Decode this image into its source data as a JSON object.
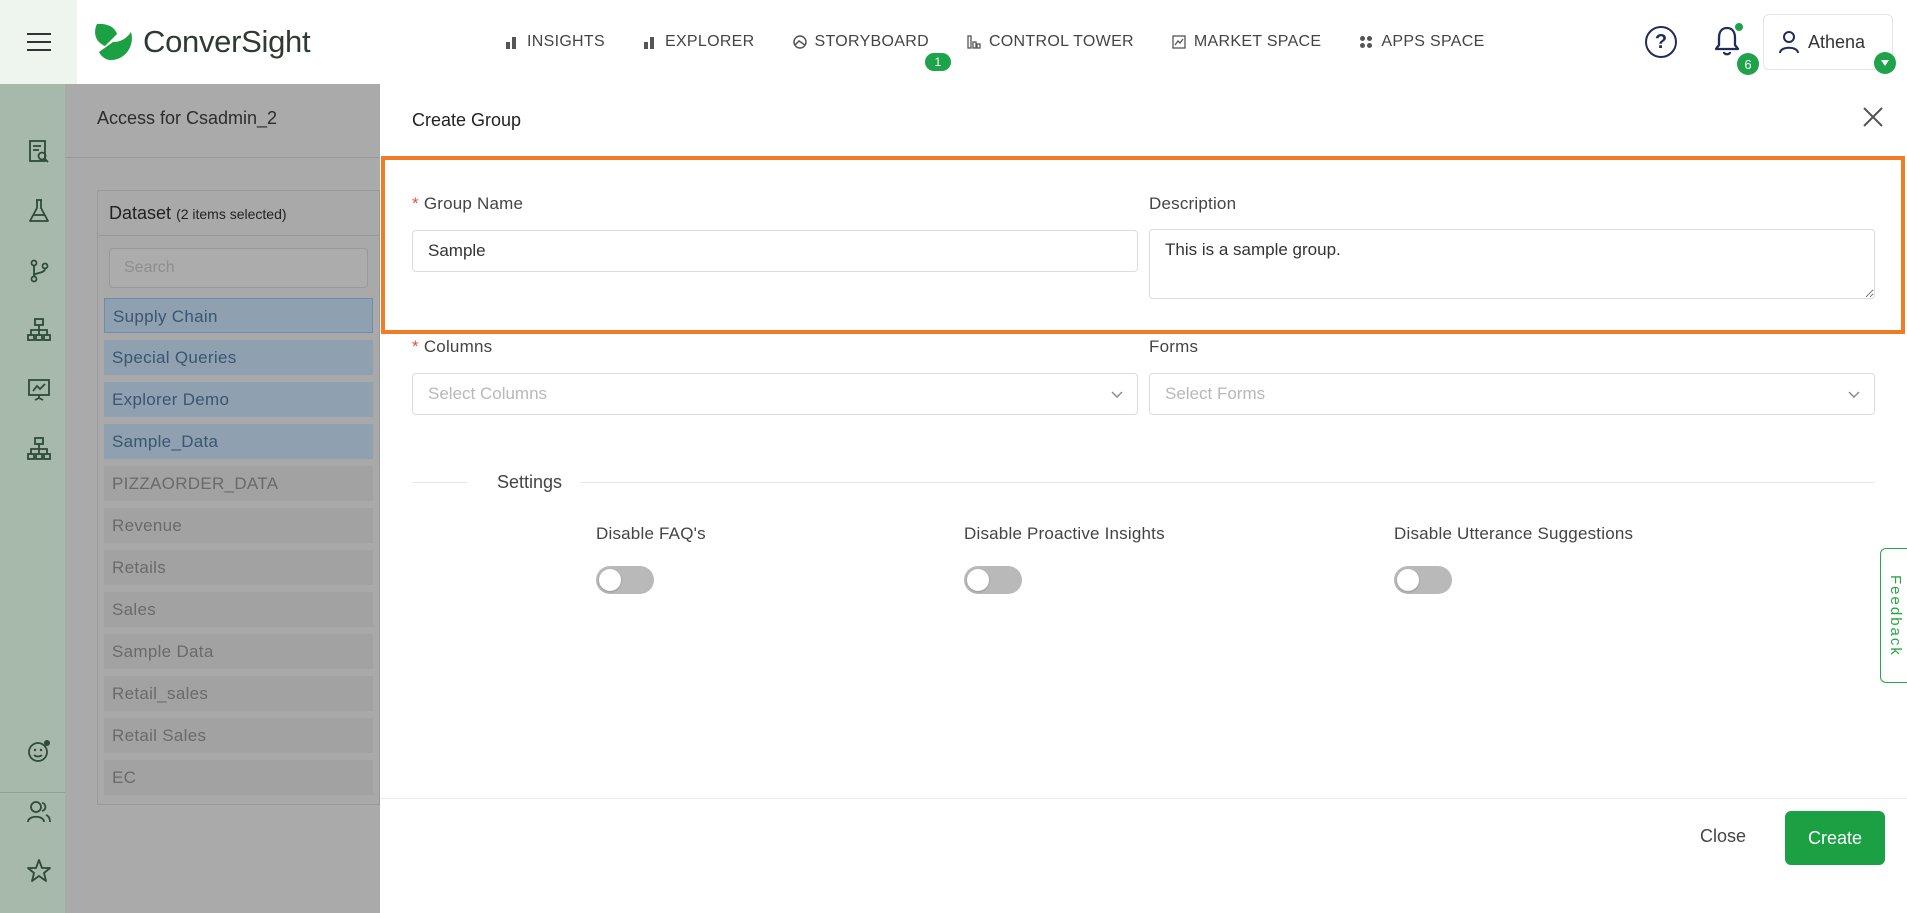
{
  "app": {
    "logo_text": "ConverSight",
    "nav": [
      {
        "label": "INSIGHTS",
        "icon": "bar-chart-icon"
      },
      {
        "label": "EXPLORER",
        "icon": "bar-chart-icon"
      },
      {
        "label": "STORYBOARD",
        "icon": "storyboard-icon",
        "badge": "1"
      },
      {
        "label": "CONTROL TOWER",
        "icon": "tower-icon"
      },
      {
        "label": "MARKET SPACE",
        "icon": "market-icon"
      },
      {
        "label": "APPS SPACE",
        "icon": "apps-grid-icon"
      }
    ],
    "help_label": "?",
    "notification_count": "6",
    "user_name": "Athena"
  },
  "background_page": {
    "title": "Access for Csadmin_2",
    "dataset_label": "Dataset",
    "dataset_selected_note": "(2 items selected)",
    "search_placeholder": "Search",
    "datasets": [
      {
        "name": "Supply Chain",
        "selected": true
      },
      {
        "name": "Special Queries",
        "selected": true
      },
      {
        "name": "Explorer Demo",
        "selected": true
      },
      {
        "name": "Sample_Data",
        "selected": true
      },
      {
        "name": "PIZZAORDER_DATA",
        "selected": false
      },
      {
        "name": "Revenue",
        "selected": false
      },
      {
        "name": "Retails",
        "selected": false
      },
      {
        "name": "Sales",
        "selected": false
      },
      {
        "name": "Sample Data",
        "selected": false
      },
      {
        "name": "Retail_sales",
        "selected": false
      },
      {
        "name": "Retail Sales",
        "selected": false
      },
      {
        "name": "EC",
        "selected": false
      }
    ]
  },
  "modal": {
    "title": "Create Group",
    "group_name_label": "Group Name",
    "group_name_value": "Sample",
    "description_label": "Description",
    "description_value": "This is a sample group.",
    "columns_label": "Columns",
    "columns_placeholder": "Select Columns",
    "forms_label": "Forms",
    "forms_placeholder": "Select Forms",
    "settings_title": "Settings",
    "toggles": [
      {
        "label": "Disable FAQ's",
        "on": false
      },
      {
        "label": "Disable Proactive Insights",
        "on": false
      },
      {
        "label": "Disable Utterance Suggestions",
        "on": false
      }
    ],
    "close_label": "Close",
    "create_label": "Create"
  },
  "feedback_label": "Feedback",
  "colors": {
    "brand_green": "#1ba043",
    "highlight_orange": "#f07d25",
    "required_red": "#e0533b"
  }
}
